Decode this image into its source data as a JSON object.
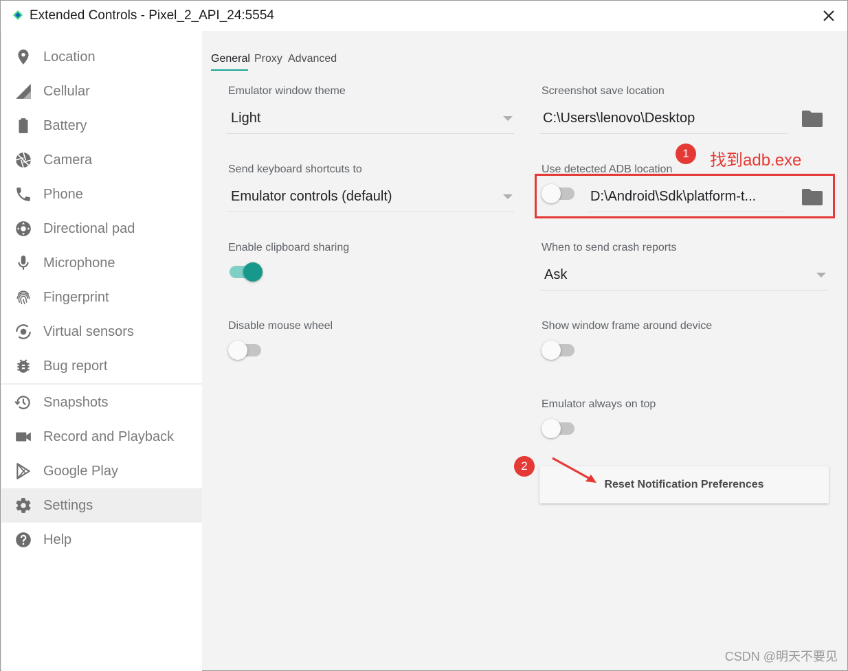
{
  "window": {
    "title": "Extended Controls - Pixel_2_API_24:5554",
    "close_icon": "close-icon"
  },
  "sidebar": {
    "items": [
      {
        "label": "Location",
        "icon": "location-pin-icon"
      },
      {
        "label": "Cellular",
        "icon": "cellular-signal-icon"
      },
      {
        "label": "Battery",
        "icon": "battery-icon"
      },
      {
        "label": "Camera",
        "icon": "camera-aperture-icon"
      },
      {
        "label": "Phone",
        "icon": "phone-icon"
      },
      {
        "label": "Directional pad",
        "icon": "dpad-icon"
      },
      {
        "label": "Microphone",
        "icon": "microphone-icon"
      },
      {
        "label": "Fingerprint",
        "icon": "fingerprint-icon"
      },
      {
        "label": "Virtual sensors",
        "icon": "rotate-icon"
      },
      {
        "label": "Bug report",
        "icon": "bug-icon"
      },
      {
        "label": "Snapshots",
        "icon": "history-icon"
      },
      {
        "label": "Record and Playback",
        "icon": "videocam-icon"
      },
      {
        "label": "Google Play",
        "icon": "play-store-icon"
      },
      {
        "label": "Settings",
        "icon": "gear-icon",
        "active": true
      },
      {
        "label": "Help",
        "icon": "help-icon"
      }
    ]
  },
  "tabs": [
    {
      "label": "General",
      "active": true
    },
    {
      "label": "Proxy"
    },
    {
      "label": "Advanced"
    }
  ],
  "settings": {
    "theme": {
      "label": "Emulator window theme",
      "value": "Light"
    },
    "shortcuts": {
      "label": "Send keyboard shortcuts to",
      "value": "Emulator controls (default)"
    },
    "clipboard": {
      "label": "Enable clipboard sharing",
      "on": true
    },
    "mouse_wheel": {
      "label": "Disable mouse wheel",
      "on": false
    },
    "screenshot": {
      "label": "Screenshot save location",
      "value": "C:\\Users\\lenovo\\Desktop"
    },
    "adb": {
      "label": "Use detected ADB location",
      "value": "D:\\Android\\Sdk\\platform-t...",
      "on": false
    },
    "crash": {
      "label": "When to send crash reports",
      "value": "Ask"
    },
    "frame": {
      "label": "Show window frame around device",
      "on": false
    },
    "on_top": {
      "label": "Emulator always on top",
      "on": false
    },
    "reset_button": "Reset Notification Preferences"
  },
  "annotations": {
    "badge1": "1",
    "badge2": "2",
    "note1": "找到adb.exe",
    "color": "#e53935"
  },
  "watermark": "CSDN @明天不要见",
  "colors": {
    "accent": "#16998b",
    "accent_track": "#7fcfc4"
  }
}
